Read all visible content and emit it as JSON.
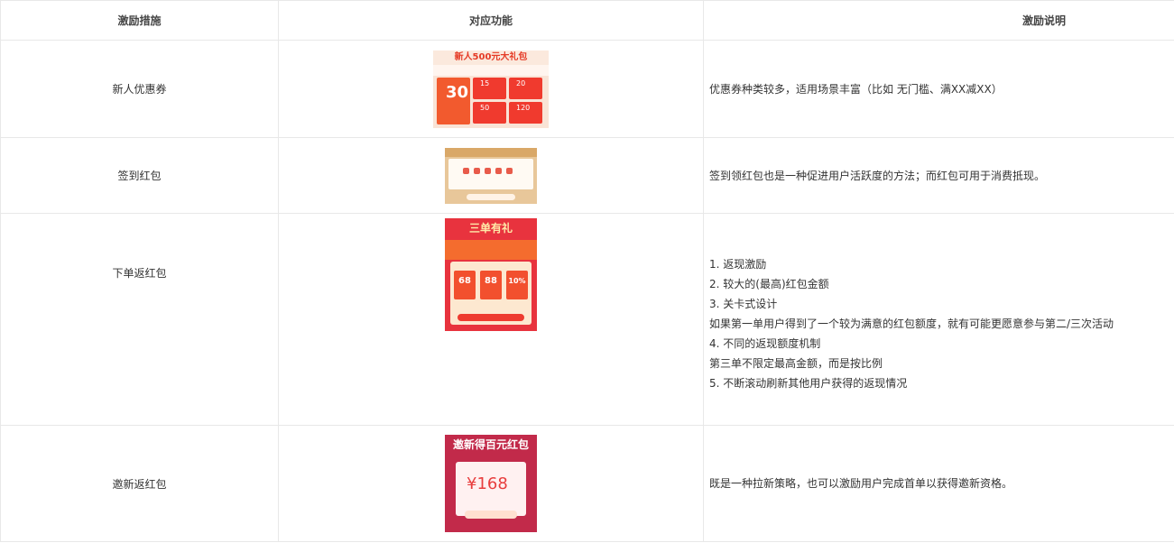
{
  "headers": [
    "激励措施",
    "对应功能",
    "激励说明"
  ],
  "rows": [
    {
      "measure": "新人优惠券",
      "image": {
        "banner": "新人500元大礼包",
        "amounts": [
          "30",
          "15",
          "20",
          "50",
          "120"
        ]
      },
      "desc": [
        "优惠券种类较多，适用场景丰富（比如 无门槛、满XX减XX）"
      ]
    },
    {
      "measure": "签到红包",
      "desc": [
        "签到领红包也是一种促进用户活跃度的方法；而红包可用于消费抵现。"
      ]
    },
    {
      "measure": "下单返红包",
      "image": {
        "banner": "三单有礼",
        "amounts": [
          "68",
          "88",
          "10%"
        ]
      },
      "desc": [
        "1.  返现激励",
        "2.  较大的(最高)红包金额",
        "3.  关卡式设计",
        "如果第一单用户得到了一个较为满意的红包额度，就有可能更愿意参与第二/三次活动",
        "4.  不同的返现额度机制",
        "第三单不限定最高金额，而是按比例",
        "5.  不断滚动刷新其他用户获得的返现情况"
      ]
    },
    {
      "measure": "邀新返红包",
      "image": {
        "banner": "邀新得百元红包",
        "amount": "¥168"
      },
      "desc": [
        "既是一种拉新策略，也可以激励用户完成首单以获得邀新资格。"
      ]
    }
  ]
}
